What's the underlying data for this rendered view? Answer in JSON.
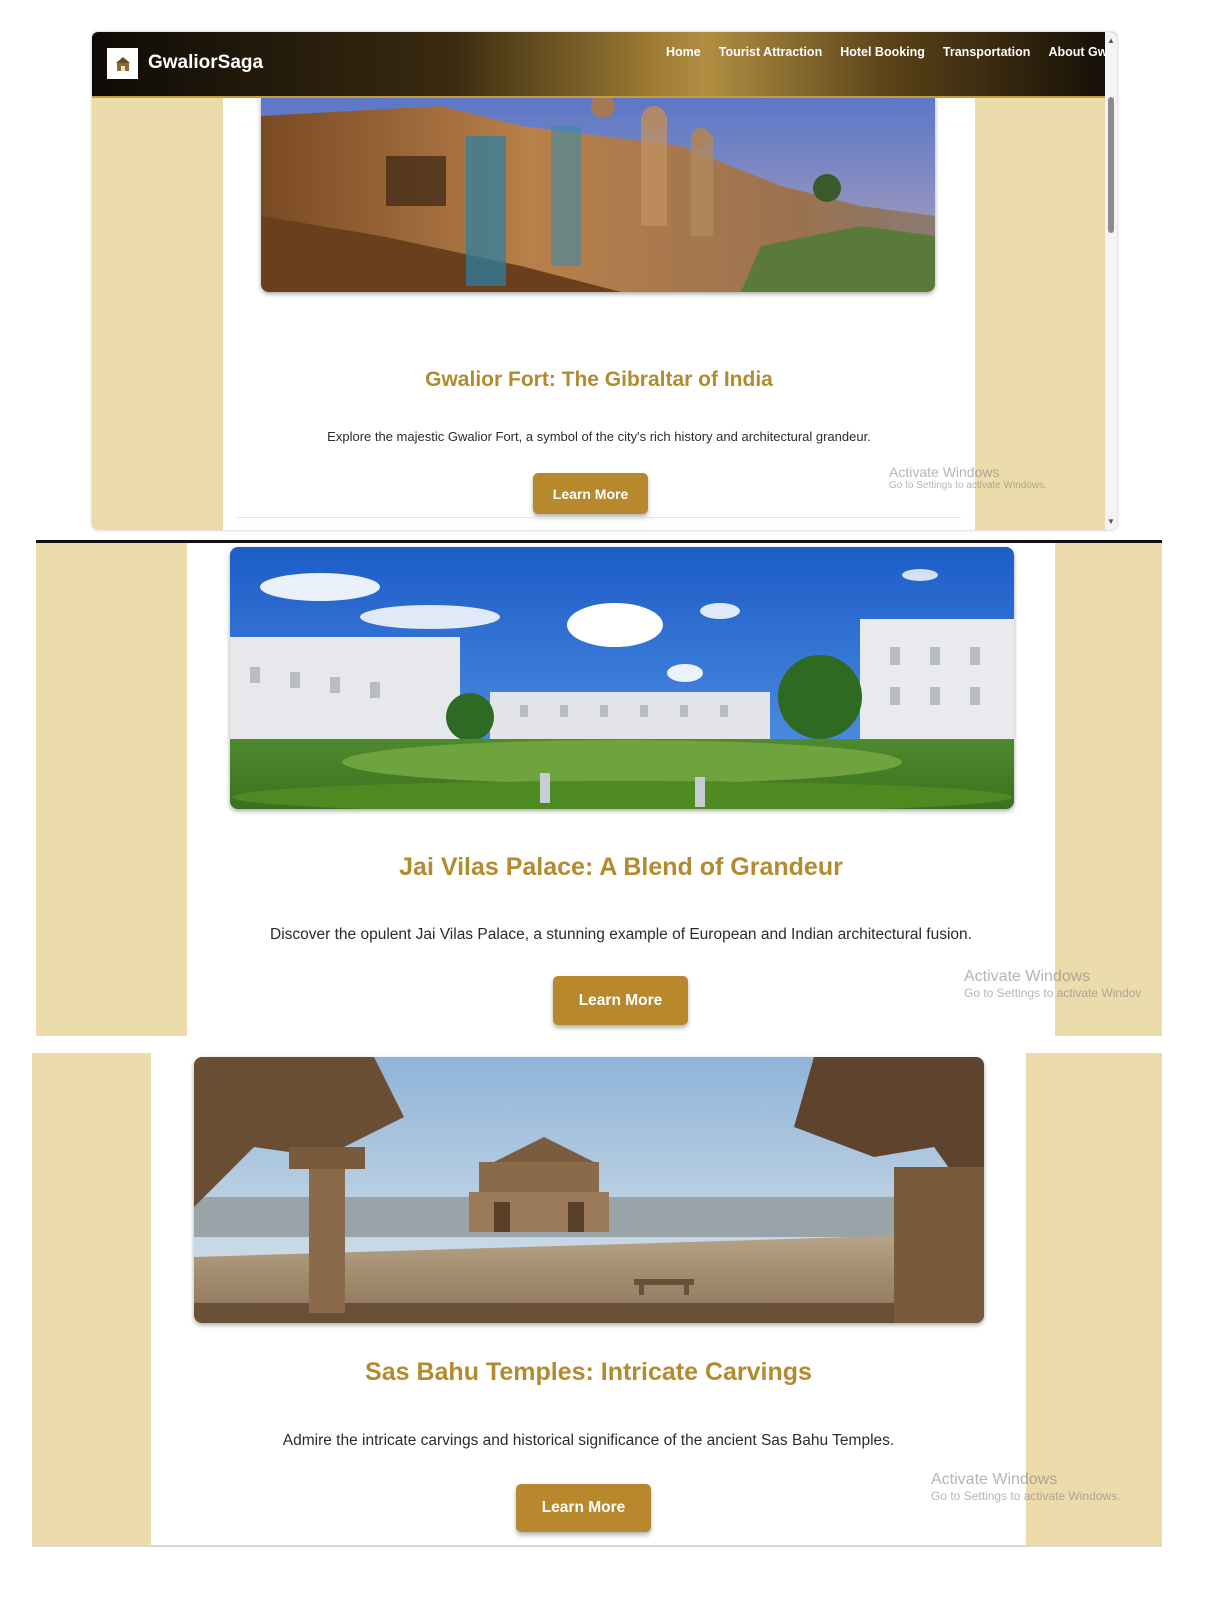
{
  "header": {
    "brand": "GwaliorSaga",
    "nav": [
      "Home",
      "Tourist Attraction",
      "Hotel Booking",
      "Transportation",
      "About Gwal"
    ]
  },
  "cards": [
    {
      "title": "Gwalior Fort: The Gibraltar of India",
      "description": "Explore the majestic Gwalior Fort, a symbol of the city's rich history and architectural grandeur.",
      "button": "Learn More"
    },
    {
      "title": "Jai Vilas Palace: A Blend of Grandeur",
      "description": "Discover the opulent Jai Vilas Palace, a stunning example of European and Indian architectural fusion.",
      "button": "Learn More"
    },
    {
      "title": "Sas Bahu Temples: Intricate Carvings",
      "description": "Admire the intricate carvings and historical significance of the ancient Sas Bahu Temples.",
      "button": "Learn More"
    }
  ],
  "watermarks": [
    {
      "title": "Activate Windows",
      "subtitle": "Go to Settings to activate Windows."
    },
    {
      "title": "Activate Windows",
      "subtitle": "Go to Settings to activate Windov"
    },
    {
      "title": "Activate Windows",
      "subtitle": "Go to Settings to activate Windows."
    }
  ],
  "colors": {
    "accent": "#b48a2e",
    "button": "#b8892c",
    "page_background": "#ecdcac",
    "navbar_dark": "#0e0b06"
  },
  "icons": [
    "logo-icon",
    "scroll-up-arrow-icon",
    "scroll-down-arrow-icon"
  ]
}
